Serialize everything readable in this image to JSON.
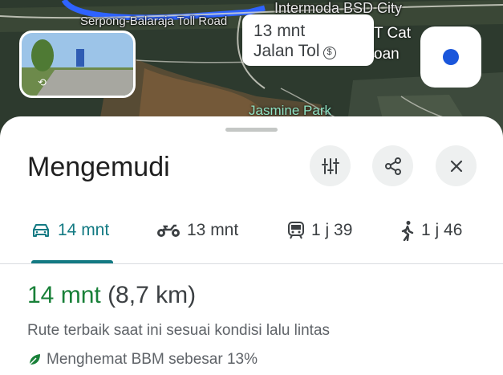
{
  "map": {
    "road_label": "Serpong-Balaraja Toll Road",
    "area_label_1": "Intermoda BSD City",
    "area_label_2": "T Cat",
    "area_label_3": "oan",
    "poi_label": "Jasmine Park",
    "route_bubble": {
      "time": "13 mnt",
      "via": "Jalan Tol"
    }
  },
  "sheet": {
    "title": "Mengemudi",
    "modes": [
      {
        "label": "14 mnt",
        "icon": "car-icon",
        "active": true
      },
      {
        "label": "13 mnt",
        "icon": "motorcycle-icon",
        "active": false
      },
      {
        "label": "1 j 39",
        "icon": "transit-icon",
        "active": false
      },
      {
        "label": "1 j 46",
        "icon": "walk-icon",
        "active": false
      }
    ],
    "route": {
      "time": "14 mnt",
      "distance": "(8,7 km)",
      "description": "Rute terbaik saat ini sesuai kondisi lalu lintas",
      "eco": "Menghemat BBM sebesar 13%"
    }
  },
  "colors": {
    "accent": "#137a83",
    "time_green": "#188038",
    "route_blue": "#1a56db"
  }
}
